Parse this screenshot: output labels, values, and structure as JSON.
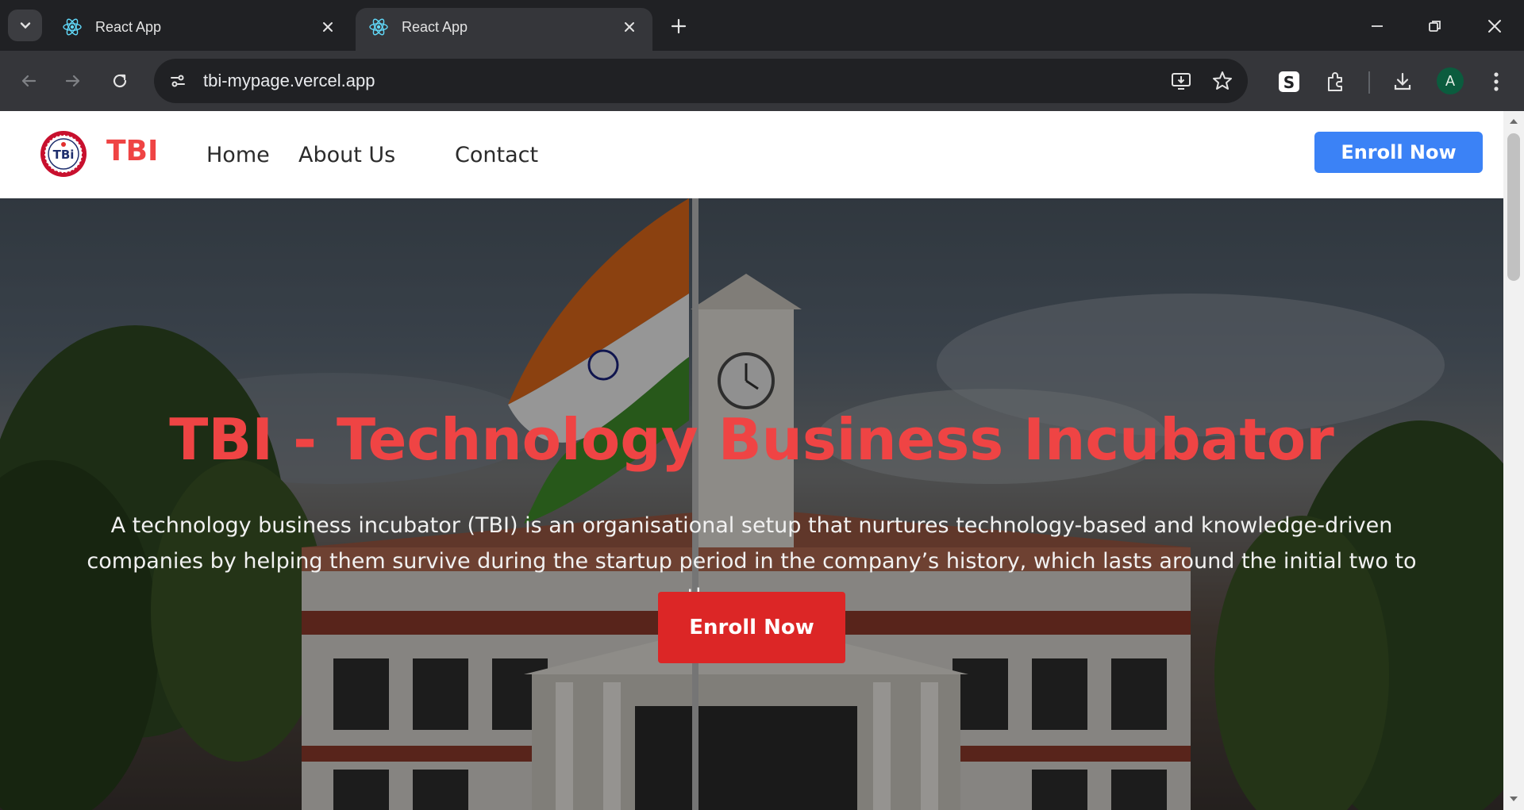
{
  "browser": {
    "tabs": [
      {
        "title": "React App",
        "favicon": "react-icon",
        "active": false
      },
      {
        "title": "React App",
        "favicon": "react-icon",
        "active": true
      }
    ],
    "url": "tbi-mypage.vercel.app",
    "profile_initial": "A"
  },
  "page": {
    "brand": "TBI",
    "nav": [
      "Home",
      "About Us",
      "Contact"
    ],
    "nav_enroll": "Enroll Now",
    "hero": {
      "title": "TBI - Technology Business Incubator",
      "description": "A technology business incubator (TBI) is an organisational setup that nurtures technology-based and knowledge-driven companies by helping them survive during the startup period in the company’s history, which lasts around the initial two to three years.",
      "cta": "Enroll Now",
      "background": "campus-building-with-flag-photo"
    }
  },
  "colors": {
    "brand_red": "#ef4444",
    "cta_red": "#dc2626",
    "nav_blue": "#3b82f6"
  }
}
